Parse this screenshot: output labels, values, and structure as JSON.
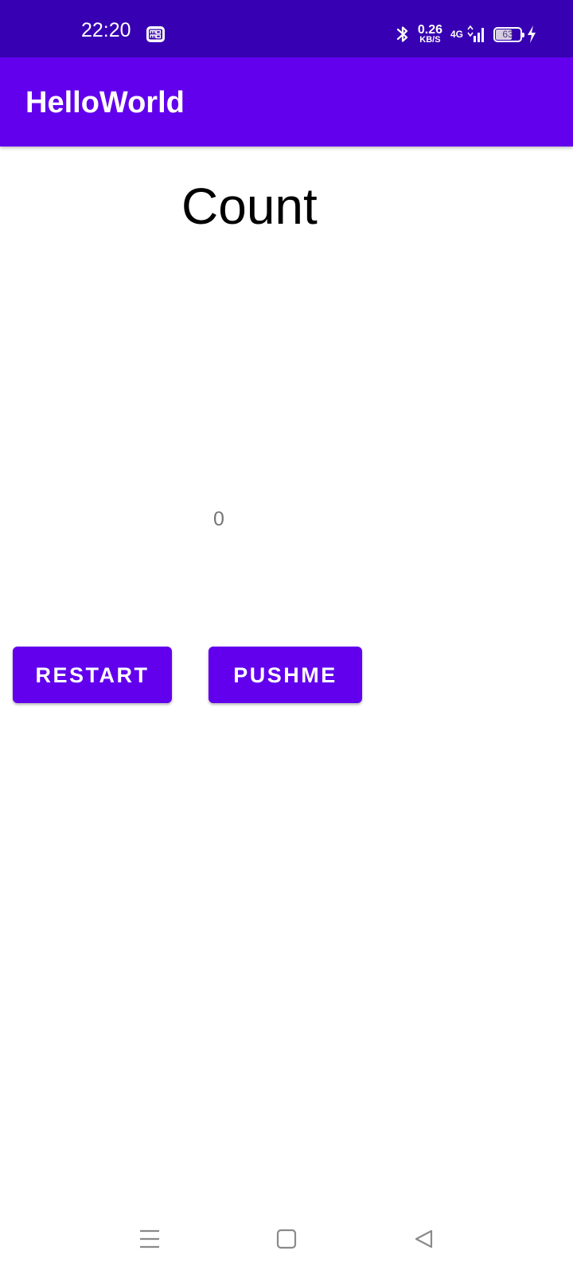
{
  "status_bar": {
    "time": "22:20",
    "app_icon": "momo-notification-icon",
    "bluetooth_icon": "bluetooth-icon",
    "net_speed_value": "0.26",
    "net_speed_unit": "KB/S",
    "network_type": "4G",
    "signal_icon": "cell-signal-icon",
    "battery_level": "63",
    "charging_icon": "charging-bolt-icon"
  },
  "app_bar": {
    "title": "HelloWorld"
  },
  "main": {
    "heading": "Count",
    "count_value": "0",
    "restart_label": "RESTART",
    "pushme_label": "PUSHME"
  },
  "nav_bar": {
    "menu_icon": "recent-apps-icon",
    "home_icon": "home-icon",
    "back_icon": "back-icon"
  },
  "colors": {
    "status_bar": "#3700b3",
    "app_bar": "#6200ee",
    "button": "#6200ee",
    "count_value_text": "#757575"
  }
}
